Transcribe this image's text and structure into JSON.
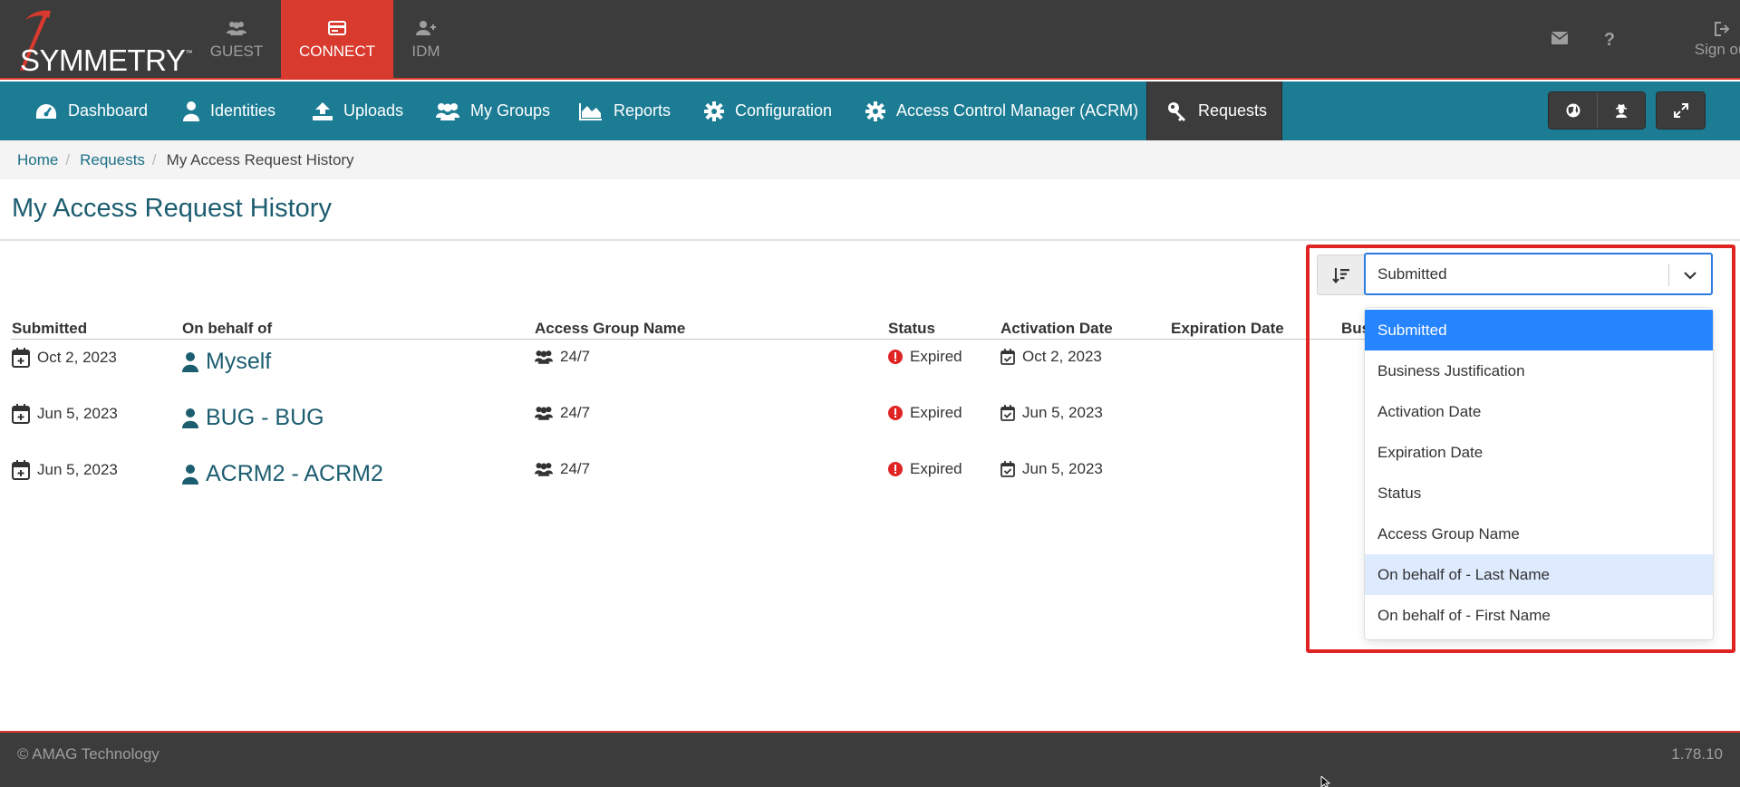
{
  "brand": {
    "name": "SYMMETRY",
    "tm": "™"
  },
  "app_tabs": [
    {
      "label": "GUEST",
      "icon": "users-icon"
    },
    {
      "label": "CONNECT",
      "icon": "id-card-icon",
      "active": true
    },
    {
      "label": "IDM",
      "icon": "user-plus-icon"
    }
  ],
  "top_right": {
    "mail_icon": "envelope-icon",
    "help_icon": "question-icon",
    "signout_label": "Sign out"
  },
  "nav": {
    "items": [
      {
        "label": "Dashboard",
        "icon": "dashboard-icon"
      },
      {
        "label": "Identities",
        "icon": "user-icon"
      },
      {
        "label": "Uploads",
        "icon": "upload-icon"
      },
      {
        "label": "My Groups",
        "icon": "users-icon"
      },
      {
        "label": "Reports",
        "icon": "area-chart-icon"
      },
      {
        "label": "Configuration",
        "icon": "gear-icon"
      },
      {
        "label": "Access Control Manager (ACRM)",
        "icon": "gear-icon"
      },
      {
        "label": "Requests",
        "icon": "key-icon",
        "active": true
      }
    ],
    "right_buttons": [
      "globe-icon",
      "user-secret-icon",
      "expand-icon"
    ]
  },
  "breadcrumb": {
    "home": "Home",
    "requests": "Requests",
    "current": "My Access Request History"
  },
  "page_title": "My Access Request History",
  "table": {
    "headers": {
      "submitted": "Submitted",
      "on_behalf_of": "On behalf of",
      "access_group_name": "Access Group Name",
      "status": "Status",
      "activation_date": "Activation Date",
      "expiration_date": "Expiration Date",
      "business": "Bus"
    },
    "rows": [
      {
        "submitted": "Oct 2, 2023",
        "on_behalf_of": "Myself",
        "access_group": "24/7",
        "status": "Expired",
        "activation_date": "Oct 2, 2023"
      },
      {
        "submitted": "Jun 5, 2023",
        "on_behalf_of": "BUG - BUG",
        "access_group": "24/7",
        "status": "Expired",
        "activation_date": "Jun 5, 2023"
      },
      {
        "submitted": "Jun 5, 2023",
        "on_behalf_of": "ACRM2 - ACRM2",
        "access_group": "24/7",
        "status": "Expired",
        "activation_date": "Jun 5, 2023"
      }
    ]
  },
  "sort": {
    "selected": "Submitted",
    "options": [
      "Submitted",
      "Business Justification",
      "Activation Date",
      "Expiration Date",
      "Status",
      "Access Group Name",
      "On behalf of - Last Name",
      "On behalf of - First Name"
    ],
    "selected_color": "#2684ff",
    "focused_color": "#deebff"
  },
  "footer": {
    "copyright": "© AMAG Technology",
    "version": "1.78.10"
  },
  "colors": {
    "topbar": "#3c3c3c",
    "accent_red": "#d83a2e",
    "nav_teal": "#1c7c94",
    "link": "#1c5d70",
    "error": "#e02424"
  }
}
